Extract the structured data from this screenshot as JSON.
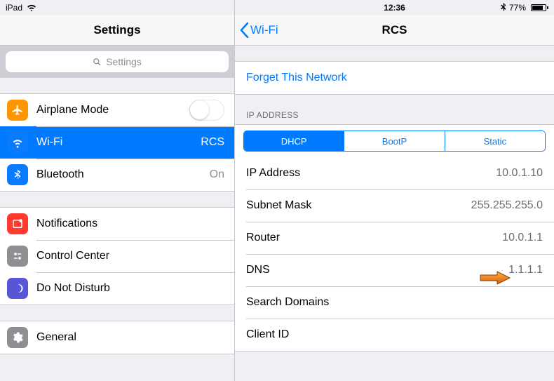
{
  "status": {
    "device": "iPad",
    "clock": "12:36",
    "battery_pct": "77%"
  },
  "left": {
    "title": "Settings",
    "search_placeholder": "Settings",
    "group1": {
      "airplane": {
        "label": "Airplane Mode"
      },
      "wifi": {
        "label": "Wi-Fi",
        "value": "RCS"
      },
      "bluetooth": {
        "label": "Bluetooth",
        "value": "On"
      }
    },
    "group2": {
      "notifications": {
        "label": "Notifications"
      },
      "control_center": {
        "label": "Control Center"
      },
      "dnd": {
        "label": "Do Not Disturb"
      }
    },
    "group3": {
      "general": {
        "label": "General"
      }
    }
  },
  "right": {
    "back_label": "Wi-Fi",
    "title": "RCS",
    "forget_label": "Forget This Network",
    "section_ip": "IP ADDRESS",
    "tabs": {
      "dhcp": "DHCP",
      "bootp": "BootP",
      "static": "Static"
    },
    "details": {
      "ip_address": {
        "label": "IP Address",
        "value": "10.0.1.10"
      },
      "subnet": {
        "label": "Subnet Mask",
        "value": "255.255.255.0"
      },
      "router": {
        "label": "Router",
        "value": "10.0.1.1"
      },
      "dns": {
        "label": "DNS",
        "value": "1.1.1.1"
      },
      "search_domains": {
        "label": "Search Domains",
        "value": ""
      },
      "client_id": {
        "label": "Client ID",
        "value": ""
      }
    }
  }
}
